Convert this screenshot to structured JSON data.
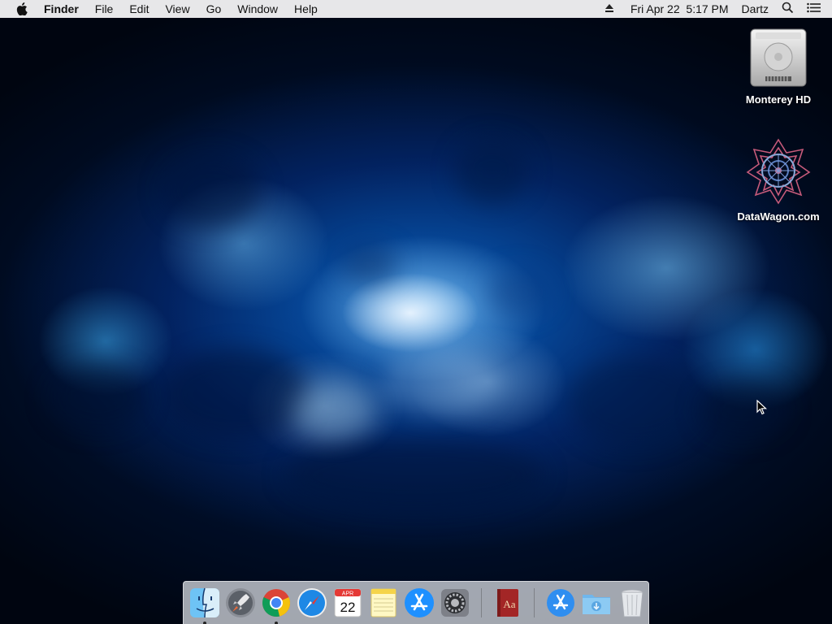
{
  "menubar": {
    "apple_icon": "apple-logo-icon",
    "app_name": "Finder",
    "menus": [
      "File",
      "Edit",
      "View",
      "Go",
      "Window",
      "Help"
    ],
    "status": {
      "eject_icon": "eject-icon",
      "clock": "Fri Apr 22  5:17 PM",
      "user": "Dartz",
      "spotlight_icon": "search-icon",
      "notification_icon": "list-icon"
    }
  },
  "desktop_icons": [
    {
      "label": "Monterey HD",
      "icon": "hard-drive-icon"
    },
    {
      "label": "DataWagon.com",
      "icon": "network-server-icon"
    }
  ],
  "dock": {
    "apps": [
      {
        "name": "Finder",
        "icon": "finder-icon",
        "running": true
      },
      {
        "name": "Launchpad",
        "icon": "launchpad-icon",
        "running": false
      },
      {
        "name": "Google Chrome",
        "icon": "chrome-icon",
        "running": true
      },
      {
        "name": "Safari",
        "icon": "safari-icon",
        "running": false
      },
      {
        "name": "Calendar",
        "icon": "calendar-icon",
        "running": false,
        "month": "APR",
        "day": "22"
      },
      {
        "name": "Notes",
        "icon": "notes-icon",
        "running": false
      },
      {
        "name": "App Store",
        "icon": "app-store-icon",
        "running": false
      },
      {
        "name": "System Preferences",
        "icon": "gear-icon",
        "running": false
      },
      {
        "name": "Dictionary",
        "icon": "dictionary-icon",
        "running": false,
        "glyph": "Aa"
      }
    ],
    "stacks": [
      {
        "name": "Applications",
        "icon": "applications-folder-icon"
      },
      {
        "name": "Downloads",
        "icon": "downloads-folder-icon"
      },
      {
        "name": "Trash",
        "icon": "trash-icon"
      }
    ]
  },
  "colors": {
    "menubar_bg": "#f0f0f2",
    "wallpaper_core": "#0a6ed2",
    "wallpaper_edge": "#000510"
  }
}
